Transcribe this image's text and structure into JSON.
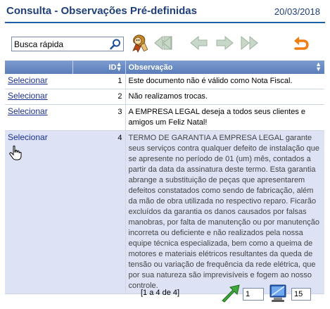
{
  "header": {
    "title": "Consulta - Observações Pré-definidas",
    "date": "20/03/2018"
  },
  "toolbar": {
    "search_value": "Busca rápida",
    "icons": [
      "search-icon",
      "mascot-icon",
      "first-page-icon",
      "prev-page-icon",
      "next-page-icon",
      "last-page-icon",
      "back-icon"
    ]
  },
  "table": {
    "columns": [
      "",
      "ID",
      "Observação"
    ],
    "rows": [
      {
        "action": "Selecionar",
        "id": "1",
        "observacao": "Este documento não é válido como Nota Fiscal."
      },
      {
        "action": "Selecionar",
        "id": "2",
        "observacao": "Não realizamos trocas."
      },
      {
        "action": "Selecionar",
        "id": "3",
        "observacao": "A EMPRESA LEGAL deseja a todos seus clientes e amigos um Feliz Natal!"
      },
      {
        "action": "Selecionar",
        "id": "4",
        "observacao": "TERMO DE GARANTIA A EMPRESA LEGAL garante seus serviços contra qualquer defeito de instalação que se apresente no período de 01 (um) mês, contados a partir da data da assinatura deste termo. Esta garantia abrange a substituição de peças que apresentarem defeitos constatados como sendo de fabricação, além da mão de obra utilizada no respectivo reparo. Ficarão excluídos da garantia os danos causados por falsas manobras, por falta de manutenção ou por manutenção incorreta ou deficiente e não realizados pela nossa equipe técnica especializada, bem como a queima de motores e materiais elétricos resultantes da queda de tensão ou variação de frequência da rede elétrica, que por sua natureza são imprevisíveis e fogem ao nosso controle."
      }
    ]
  },
  "footer": {
    "range": "[1 a 4 de 4]",
    "page_value": "1",
    "rows_value": "15"
  },
  "colors": {
    "title": "#1f3f7a",
    "header_bg": "#6a8cc4",
    "hover_row": "#dde3f5",
    "link": "#1a2f8f"
  }
}
